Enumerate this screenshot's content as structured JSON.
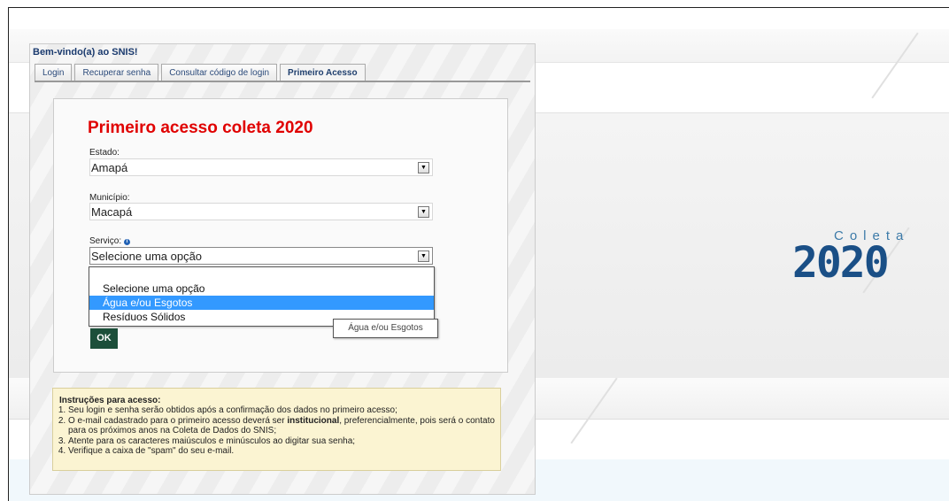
{
  "panel": {
    "title": "Bem-vindo(a) ao SNIS!",
    "tabs": [
      "Login",
      "Recuperar senha",
      "Consultar código de login",
      "Primeiro Acesso"
    ],
    "active_tab": "Primeiro Acesso"
  },
  "form": {
    "heading": "Primeiro acesso coleta 2020",
    "estado": {
      "label": "Estado:",
      "value": "Amapá"
    },
    "municipio": {
      "label": "Município:",
      "value": "Macapá"
    },
    "servico": {
      "label": "Serviço:",
      "value": "Selecione uma opção",
      "info_icon": "info-icon"
    },
    "submit_label": "OK"
  },
  "dropdown": {
    "options": [
      "Selecione uma opção",
      "Água e/ou Esgotos",
      "Resíduos Sólidos"
    ],
    "highlighted": "Água e/ou Esgotos"
  },
  "tooltip": "Água e/ou Esgotos",
  "logo": {
    "word": "Coleta",
    "year": "2020"
  },
  "instructions": {
    "title": "Instruções para acesso:",
    "items": [
      "Seu login e senha serão obtidos após a confirmação dos dados no primeiro acesso;",
      "O e-mail cadastrado para o primeiro acesso deverá ser",
      "institucional",
      ", preferencialmente, pois será o contato para os próximos anos na Coleta de Dados do SNIS;",
      "Atente para os caracteres maiúsculos e minúsculos ao digitar sua senha;",
      "Verifique a caixa de \"spam\" do seu e-mail."
    ]
  },
  "colors": {
    "heading": "#e00000",
    "ok_button": "#1c4f3a",
    "highlight": "#3399ff",
    "logo": "#1a4f86"
  }
}
